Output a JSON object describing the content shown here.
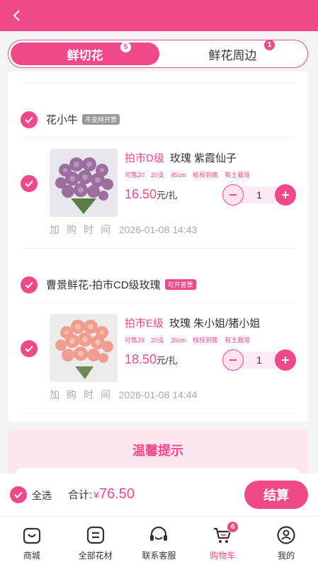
{
  "colors": {
    "accent": "#f0498a",
    "tips_bg": "#fde6ee"
  },
  "tabs": [
    {
      "label": "鲜切花",
      "badge": "5",
      "active": true
    },
    {
      "label": "鲜花周边",
      "badge": "1",
      "active": false
    }
  ],
  "shops": [
    {
      "name": "花小牛",
      "tag": "不支持开票",
      "items": [
        {
          "grade": "拍市D级",
          "name": "玫瑰 紫霞仙子",
          "specs": [
            "可售20",
            "20支",
            "45cm",
            "枝枝到底",
            "有土栽培"
          ],
          "price": "16.50",
          "unit": "元/扎",
          "qty": "1",
          "added_label": "加购时间",
          "added_time": "2026-01-08 14:43",
          "image": "purple-roses"
        }
      ]
    },
    {
      "name": "曹景鲜花-拍市CD级玫瑰",
      "tag": "可开普票",
      "items": [
        {
          "grade": "拍市E级",
          "name": "玫瑰 朱小姐/猪小姐",
          "specs": [
            "可售39",
            "20支",
            "35cm",
            "枝枝到底",
            "有土栽培"
          ],
          "price": "18.50",
          "unit": "元/扎",
          "qty": "1",
          "added_label": "加购时间",
          "added_time": "2026-01-08 14:44",
          "image": "peach-roses"
        }
      ]
    }
  ],
  "tips": {
    "title": "温馨提示"
  },
  "footer": {
    "select_all": "全选",
    "total_label": "合计:",
    "currency": "¥",
    "total": "76.50",
    "checkout": "结算"
  },
  "tabbar": [
    {
      "label": "商城",
      "icon": "shop-icon"
    },
    {
      "label": "全部花材",
      "icon": "list-icon"
    },
    {
      "label": "联系客服",
      "icon": "headset-icon"
    },
    {
      "label": "购物车",
      "icon": "cart-icon",
      "badge": "6",
      "active": true
    },
    {
      "label": "我的",
      "icon": "user-icon"
    }
  ]
}
